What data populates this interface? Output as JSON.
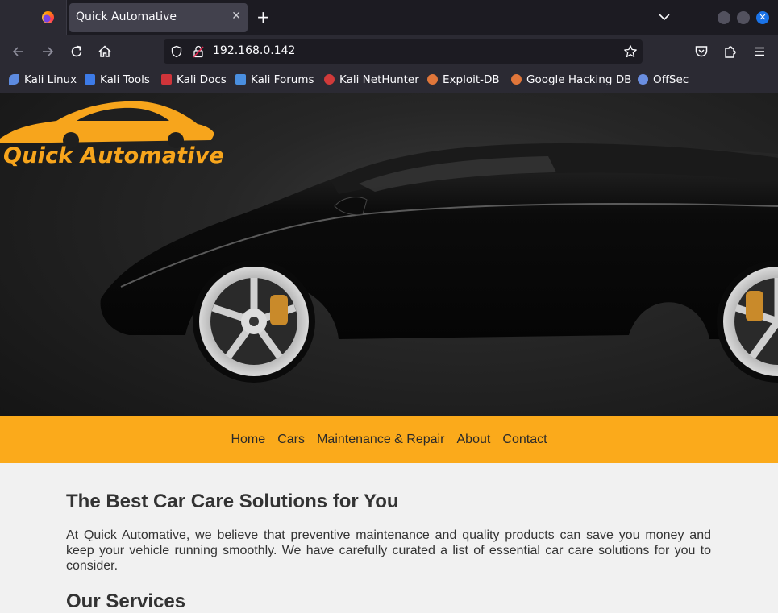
{
  "browser": {
    "tab_title": "Quick Automative",
    "url": "192.168.0.142",
    "bookmarks": [
      {
        "label": "Kali Linux",
        "icon": "kali-dragon-icon",
        "color": "#5d8be0"
      },
      {
        "label": "Kali Tools",
        "icon": "kali-tools-icon",
        "color": "#3d7be8"
      },
      {
        "label": "Kali Docs",
        "icon": "kali-docs-icon",
        "color": "#d0343a"
      },
      {
        "label": "Kali Forums",
        "icon": "kali-forums-icon",
        "color": "#4a8fe0"
      },
      {
        "label": "Kali NetHunter",
        "icon": "nethunter-icon",
        "color": "#d03a3a"
      },
      {
        "label": "Exploit-DB",
        "icon": "exploit-db-icon",
        "color": "#e0763a"
      },
      {
        "label": "Google Hacking DB",
        "icon": "ghdb-icon",
        "color": "#e0763a"
      },
      {
        "label": "OffSec",
        "icon": "offsec-icon",
        "color": "#6a8ee0"
      }
    ]
  },
  "site": {
    "logo_text": "Quick Automative",
    "nav": [
      "Home",
      "Cars",
      "Maintenance & Repair",
      "About",
      "Contact"
    ],
    "heading": "The Best Car Care Solutions for You",
    "intro": "At Quick Automative, we believe that preventive maintenance and quality products can save you money and keep your vehicle running smoothly. We have carefully curated a list of essential car care solutions for you to consider.",
    "subheading": "Our Services"
  },
  "colors": {
    "accent": "#fbaa1b",
    "logo": "#f7a51c",
    "chrome_dark": "#1c1b22",
    "chrome": "#2b2a33"
  }
}
